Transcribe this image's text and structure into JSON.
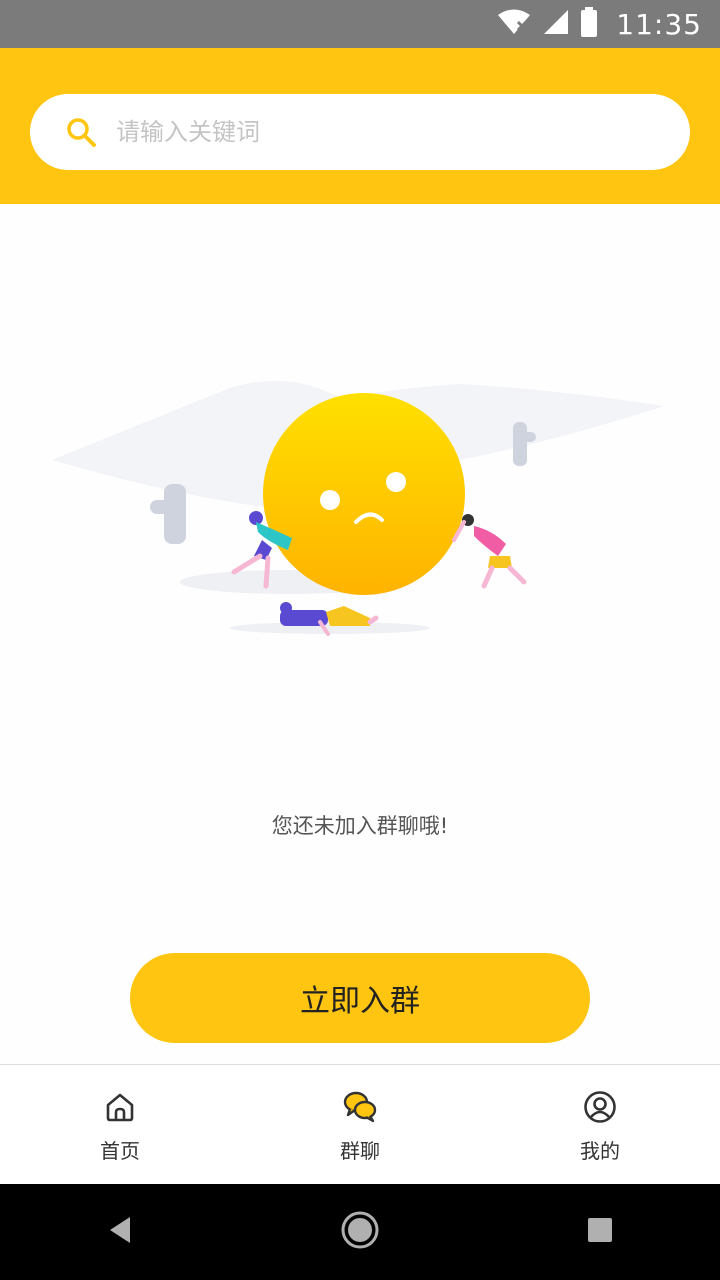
{
  "status_bar": {
    "time": "11:35"
  },
  "search": {
    "placeholder": "请输入关键词",
    "value": ""
  },
  "empty_state": {
    "message": "您还未加入群聊哦!"
  },
  "join_button": {
    "label": "立即入群"
  },
  "tabs": [
    {
      "label": "首页",
      "icon": "home-icon"
    },
    {
      "label": "群聊",
      "icon": "chat-bubbles-icon"
    },
    {
      "label": "我的",
      "icon": "user-circle-icon"
    }
  ],
  "colors": {
    "accent": "#ffc510",
    "status_bar": "#7b7b7b",
    "nav_bar": "#000000"
  }
}
